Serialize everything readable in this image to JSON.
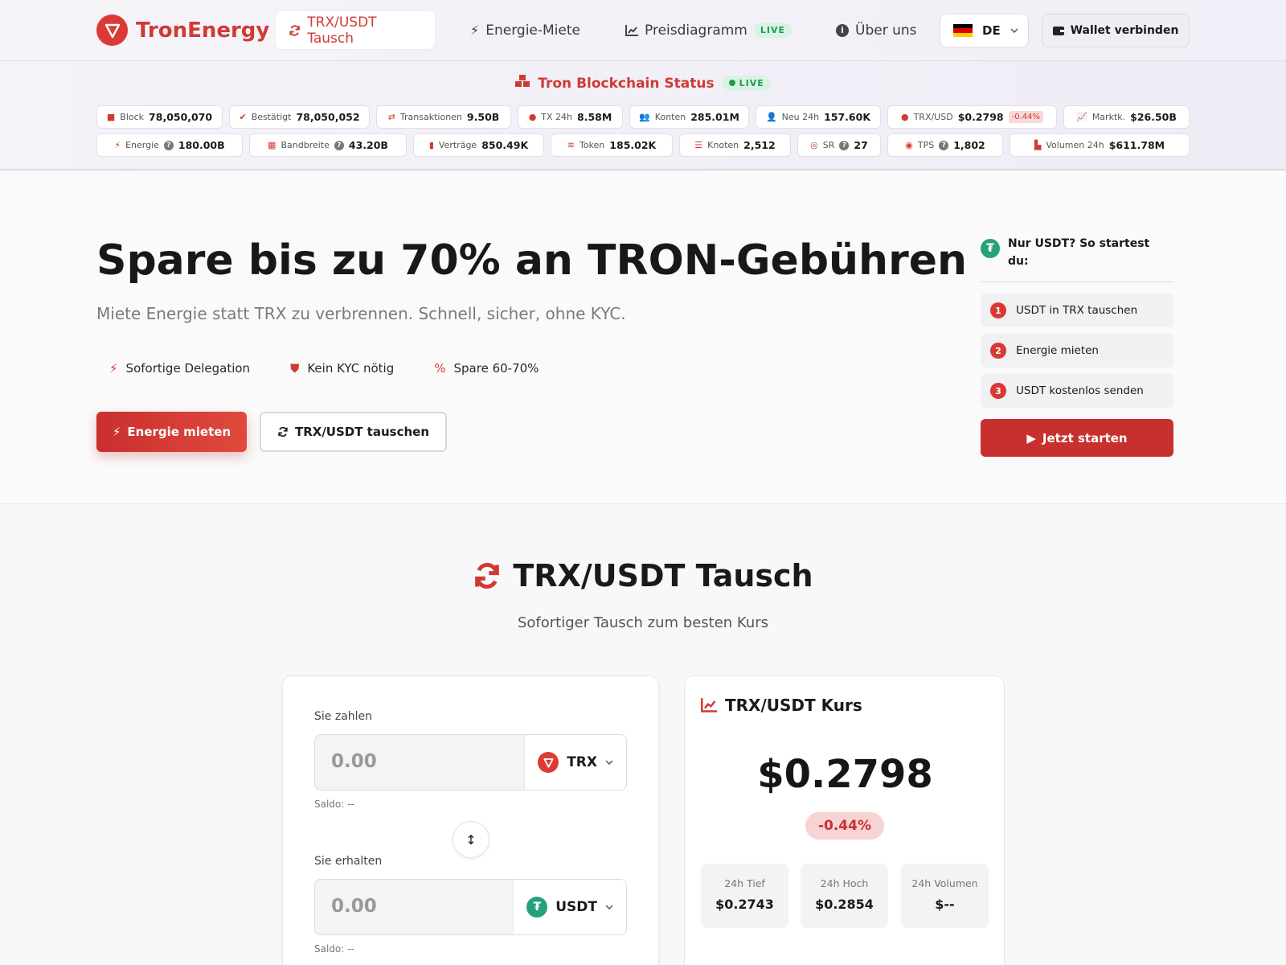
{
  "nav": {
    "brand": "TronEnergy",
    "items": [
      {
        "label": "TRX/USDT Tausch",
        "icon": "refresh-icon"
      },
      {
        "label": "Energie-Miete",
        "icon": "bolt-icon"
      },
      {
        "label": "Preisdiagramm",
        "icon": "chart-icon",
        "badge": "LIVE"
      },
      {
        "label": "Über uns",
        "icon": "info-icon"
      }
    ],
    "language": "DE",
    "wallet_label": "Wallet verbinden"
  },
  "status": {
    "title": "Tron Blockchain Status",
    "live": "LIVE",
    "row1": [
      {
        "label": "Block",
        "value": "78,050,070"
      },
      {
        "label": "Bestätigt",
        "value": "78,050,052"
      },
      {
        "label": "Transaktionen",
        "value": "9.50B"
      },
      {
        "label": "TX 24h",
        "value": "8.58M"
      },
      {
        "label": "Konten",
        "value": "285.01M"
      },
      {
        "label": "Neu 24h",
        "value": "157.60K"
      },
      {
        "label": "TRX/USD",
        "value": "$0.2798",
        "change": "-0.44%"
      },
      {
        "label": "Marktk.",
        "value": "$26.50B"
      }
    ],
    "row2": [
      {
        "label": "Energie",
        "value": "180.00B"
      },
      {
        "label": "Bandbreite",
        "value": "43.20B"
      },
      {
        "label": "Verträge",
        "value": "850.49K"
      },
      {
        "label": "Token",
        "value": "185.02K"
      },
      {
        "label": "Knoten",
        "value": "2,512"
      },
      {
        "label": "SR",
        "value": "27"
      },
      {
        "label": "TPS",
        "value": "1,802"
      },
      {
        "label": "Volumen 24h",
        "value": "$611.78M"
      }
    ]
  },
  "hero": {
    "title": "Spare bis zu 70% an TRON-Gebühren",
    "subtitle": "Miete Energie statt TRX zu verbrennen. Schnell, sicher, ohne KYC.",
    "features": [
      "Sofortige Delegation",
      "Kein KYC nötig",
      "Spare 60-70%"
    ],
    "primary_cta": "Energie mieten",
    "secondary_cta": "TRX/USDT tauschen",
    "steps_title": "Nur USDT? So startest du:",
    "steps": [
      "USDT in TRX tauschen",
      "Energie mieten",
      "USDT kostenlos senden"
    ],
    "start_label": "Jetzt starten"
  },
  "swap": {
    "title": "TRX/USDT Tausch",
    "subtitle": "Sofortiger Tausch zum besten Kurs",
    "pay_label": "Sie zahlen",
    "pay_value": "0.00",
    "pay_token": "TRX",
    "pay_balance": "Saldo: --",
    "receive_label": "Sie erhalten",
    "receive_value": "0.00",
    "receive_token": "USDT",
    "receive_balance": "Saldo: --"
  },
  "rate": {
    "title": "TRX/USDT Kurs",
    "price": "$0.2798",
    "change": "-0.44%",
    "low_label": "24h Tief",
    "low": "$0.2743",
    "high_label": "24h Hoch",
    "high": "$0.2854",
    "volume_label": "24h Volumen",
    "volume": "$--"
  },
  "colors": {
    "accent": "#cf3a33",
    "usdt": "#26a17b",
    "live": "#1f9a52"
  }
}
